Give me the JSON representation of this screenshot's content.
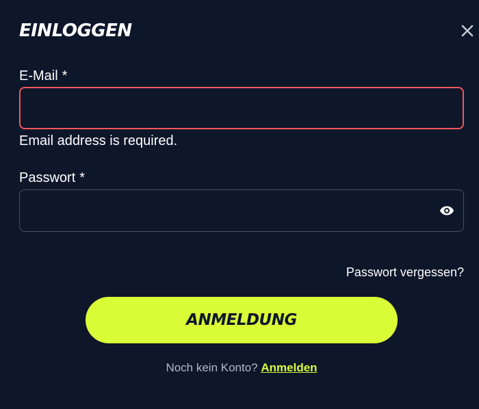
{
  "modal": {
    "title": "EINLOGGEN"
  },
  "email": {
    "label": "E-Mail",
    "required_marker": "*",
    "value": "",
    "placeholder": "",
    "error": "Email address is required."
  },
  "password": {
    "label": "Passwort",
    "required_marker": "*",
    "value": "",
    "placeholder": ""
  },
  "forgot_password": "Passwort vergessen?",
  "submit_label": "ANMELDUNG",
  "footer": {
    "prompt": "Noch kein Konto?",
    "link": "Anmelden"
  },
  "icons": {
    "close": "close-icon",
    "show_password": "eye-icon"
  },
  "colors": {
    "background": "#0e162a",
    "accent": "#dafc37",
    "error_border": "#f2585d",
    "field_border": "#4a5163",
    "muted_text": "#b4b9c4"
  }
}
